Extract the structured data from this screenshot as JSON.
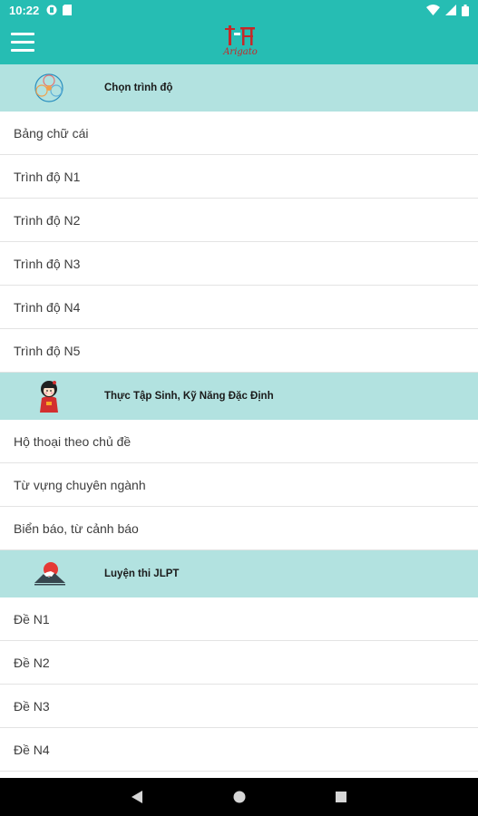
{
  "status_bar": {
    "time": "10:22",
    "icons_left": [
      "badge-icon",
      "sd-card-icon"
    ],
    "icons_right": [
      "wifi-icon",
      "signal-icon",
      "battery-icon"
    ]
  },
  "app_bar": {
    "logo_text": "Arigato",
    "brand_color": "#26bdb3"
  },
  "sections": [
    {
      "title": "Chọn trình độ",
      "icon": "flower-emblem-icon",
      "items": [
        "Bảng chữ cái",
        "Trình độ N1",
        "Trình độ N2",
        "Trình độ N3",
        "Trình độ N4",
        "Trình độ N5"
      ]
    },
    {
      "title": "Thực Tập Sinh, Kỹ Năng Đặc Định",
      "icon": "kokeshi-doll-icon",
      "items": [
        "Hộ thoại theo chủ đề",
        "Từ vựng chuyên ngành",
        "Biển báo, từ cảnh báo"
      ]
    },
    {
      "title": "Luyện thi JLPT",
      "icon": "mount-fuji-icon",
      "items": [
        "Đề N1",
        "Đề N2",
        "Đề N3",
        "Đề N4"
      ]
    }
  ],
  "header_bg_color": "#b2e2e0",
  "nav_bar": {
    "back": "back-triangle-icon",
    "home": "home-circle-icon",
    "recents": "recents-square-icon"
  }
}
